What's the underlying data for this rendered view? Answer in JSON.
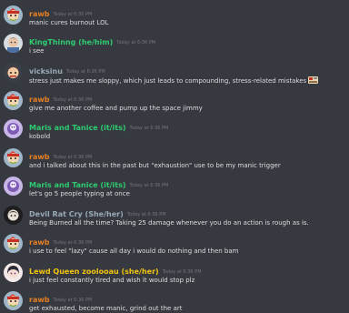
{
  "colors": {
    "background": "#36393f",
    "text": "#dcddde",
    "timestamp": "#72767d",
    "rawb": "#e67e22",
    "kingthinng": "#2ecc71",
    "vicksinu": "#99aab5",
    "maris": "#2ecc71",
    "devil": "#99aab5",
    "lewd": "#f1c40f"
  },
  "messages": [
    {
      "author": "rawb",
      "timestamp": "Today at 6:35 PM",
      "text": "manic cures burnout LOL",
      "avatar_icon": "cartoon-avatar-icon"
    },
    {
      "author": "KingThinng (he/him)",
      "timestamp": "Today at 6:36 PM",
      "text": "i see",
      "avatar_icon": "face-avatar-icon"
    },
    {
      "author": "vicksinu",
      "timestamp": "Today at 6:36 PM",
      "text": "stress just makes me sloppy, which just leads to compounding, stress-related mistakes",
      "avatar_icon": "character-avatar-icon",
      "emoji": "custom-emoji-icon"
    },
    {
      "author": "rawb",
      "timestamp": "Today at 6:36 PM",
      "text": "give me another coffee and pump up the space jimmy",
      "avatar_icon": "cartoon-avatar-icon"
    },
    {
      "author": "Maris and Tanice (it/its)",
      "timestamp": "Today at 6:36 PM",
      "text": "kobold",
      "avatar_icon": "purple-avatar-icon"
    },
    {
      "author": "rawb",
      "timestamp": "Today at 6:36 PM",
      "text": "and i talked about this in the past but \"exhaustion\" use to be my manic trigger",
      "avatar_icon": "cartoon-avatar-icon"
    },
    {
      "author": "Maris and Tanice (it/its)",
      "timestamp": "Today at 6:36 PM",
      "text": "let's go 5 people typing at once",
      "avatar_icon": "purple-avatar-icon"
    },
    {
      "author": "Devil Rat Cry (She/her)",
      "timestamp": "Today at 6:36 PM",
      "text": "Being Burned all the time? Taking 25 damage whenever you do an action is rough as is.",
      "avatar_icon": "dark-avatar-icon"
    },
    {
      "author": "rawb",
      "timestamp": "Today at 6:36 PM",
      "text": "i use to feel \"lazy\" cause all day i would do nothing and then bam",
      "avatar_icon": "cartoon-avatar-icon"
    },
    {
      "author": "Lewd Queen zoolooau (she/her)",
      "timestamp": "Today at 6:36 PM",
      "text": "i just feel constantly tired and wish it would stop plz",
      "avatar_icon": "anime-avatar-icon"
    },
    {
      "author": "rawb",
      "timestamp": "Today at 6:36 PM",
      "text": "get exhausted, become manic, grind out the art",
      "avatar_icon": "cartoon-avatar-icon"
    }
  ]
}
